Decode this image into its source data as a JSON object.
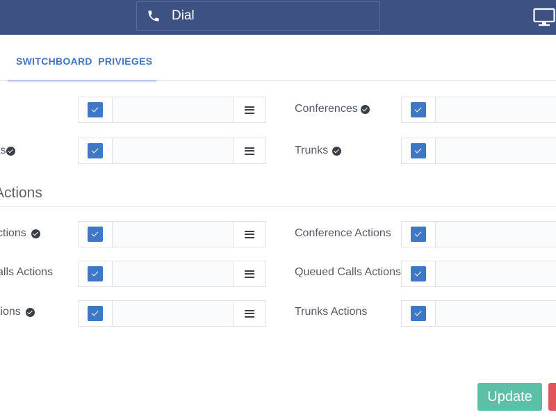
{
  "header": {
    "dial_label": "Dial",
    "phone_icon": "phone-icon",
    "monitor_icon": "monitor-icon",
    "background": "#3d5182"
  },
  "tabs": [
    {
      "label": "SWITCHBOARD  PRIVIEGES",
      "active": true
    }
  ],
  "privileges": {
    "rows": [
      {
        "left_label": "",
        "left_verified": false,
        "right_label": "Conferences",
        "right_verified": true
      },
      {
        "left_label": "ts",
        "left_verified": true,
        "right_label": "Trunks",
        "right_verified": true
      }
    ]
  },
  "actions": {
    "title": "Actions",
    "rows": [
      {
        "left_label": "ctions",
        "left_verified": true,
        "right_label": "Conference Actions",
        "right_verified": false
      },
      {
        "left_label": "alls Actions",
        "left_verified": false,
        "right_label": "Queued Calls Actions",
        "right_verified": false
      },
      {
        "left_label": "tions",
        "left_verified": true,
        "right_label": "Trunks Actions",
        "right_verified": false
      }
    ]
  },
  "checkbox_color": "#3d77c6",
  "buttons": {
    "update_label": "Update",
    "update_color": "#5cbfa7",
    "delete_color": "#e0555a"
  }
}
